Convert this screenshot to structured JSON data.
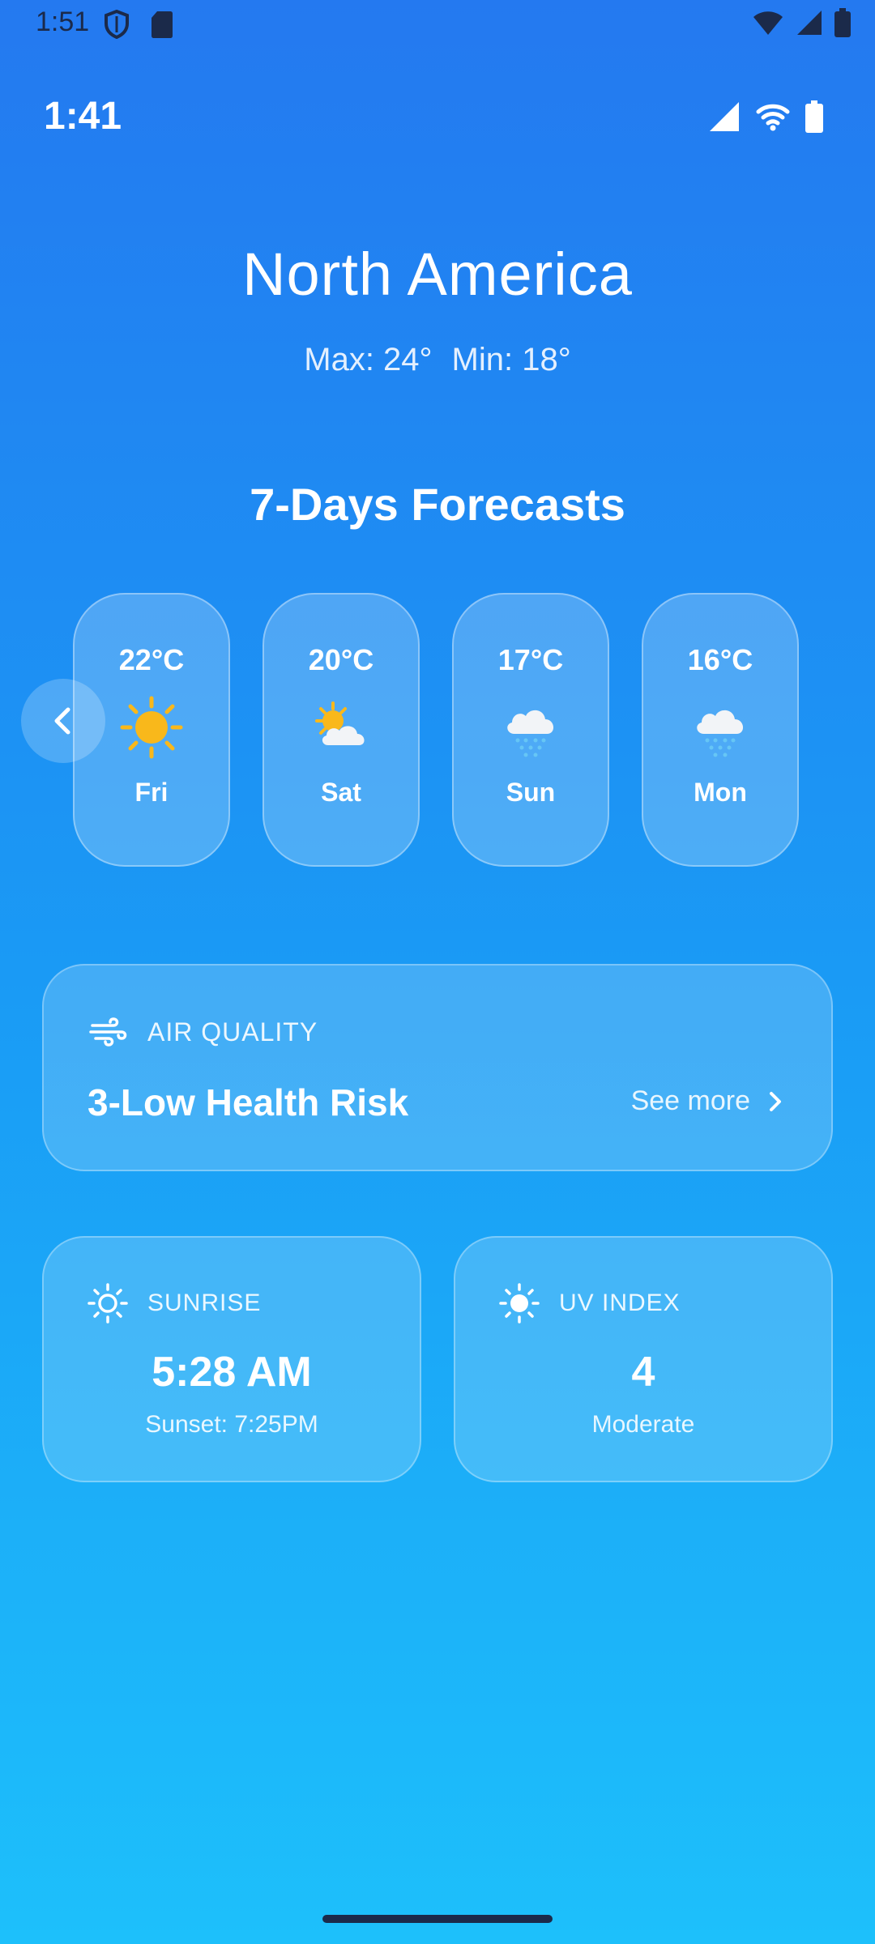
{
  "system_status": {
    "time": "1:51",
    "icons": [
      "shield-icon",
      "sd-card-icon",
      "wifi-icon",
      "cell-signal-icon",
      "battery-icon"
    ]
  },
  "app_status": {
    "time": "1:41",
    "icons": [
      "cell-signal-icon",
      "wifi-icon",
      "battery-icon"
    ]
  },
  "location": {
    "name": "North America",
    "max": "Max: 24°",
    "min": "Min: 18°"
  },
  "forecast": {
    "title": "7-Days Forecasts",
    "days": [
      {
        "temp": "22°C",
        "day": "Fri",
        "icon": "sun-icon"
      },
      {
        "temp": "20°C",
        "day": "Sat",
        "icon": "partly-cloudy-icon"
      },
      {
        "temp": "17°C",
        "day": "Sun",
        "icon": "rain-cloud-icon"
      },
      {
        "temp": "16°C",
        "day": "Mon",
        "icon": "rain-cloud-icon"
      }
    ]
  },
  "air_quality": {
    "label": "AIR QUALITY",
    "value": "3-Low Health Risk",
    "see_more": "See more"
  },
  "sunrise": {
    "label": "SUNRISE",
    "value": "5:28 AM",
    "sub": "Sunset: 7:25PM"
  },
  "uv_index": {
    "label": "UV INDEX",
    "value": "4",
    "sub": "Moderate"
  },
  "colors": {
    "gradient_top": "#2479f0",
    "gradient_bottom": "#1dc0fb",
    "sun": "#f9b81b",
    "cloud": "#f2f4f7",
    "rain": "#66c6f5"
  }
}
